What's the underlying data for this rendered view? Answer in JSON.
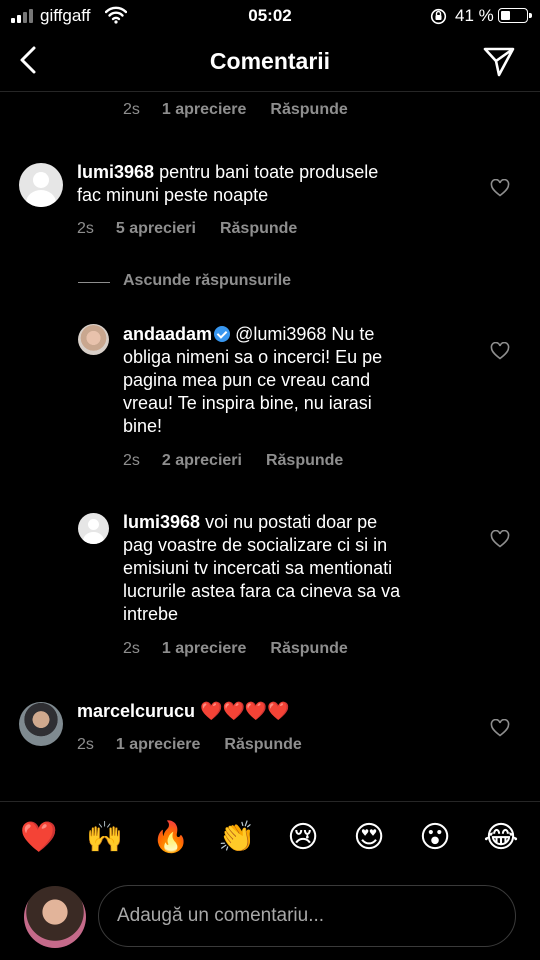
{
  "status_bar": {
    "carrier": "giffgaff",
    "time": "05:02",
    "battery_percent": "41 %",
    "battery_level": 0.41
  },
  "header": {
    "title": "Comentarii",
    "back_icon": "chevron-left-icon",
    "send_icon": "paper-plane-icon"
  },
  "comments": {
    "top_meta": {
      "time": "2s",
      "likes": "1 apreciere",
      "reply": "Răspunde"
    },
    "c1": {
      "username": "lumi3968",
      "text_line1": "pentru bani toate produsele",
      "text_line2": "fac minuni peste noapte",
      "time": "2s",
      "likes": "5 aprecieri",
      "reply": "Răspunde"
    },
    "hide_replies": "Ascunde răspunsurile",
    "r1": {
      "username": "andaadam",
      "mention": "@lumi3968",
      "text_line1": "Nu te",
      "text_line2": "obliga nimeni sa o incerci! Eu pe",
      "text_line3": "pagina mea pun ce vreau cand",
      "text_line4": "vreau! Te inspira bine, nu iarasi",
      "text_line5": "bine!",
      "time": "2s",
      "likes": "2 aprecieri",
      "reply": "Răspunde"
    },
    "r2": {
      "username": "lumi3968",
      "text_line1": "voi nu postati doar pe",
      "text_line2": "pag voastre de socializare ci si in",
      "text_line3": "emisiuni tv incercati sa mentionati",
      "text_line4": "lucrurile astea fara ca cineva sa va",
      "text_line5": "intrebe",
      "time": "2s",
      "likes": "1 apreciere",
      "reply": "Răspunde"
    },
    "c2": {
      "username": "marcelcurucu",
      "text": "❤️❤️❤️❤️",
      "time": "2s",
      "likes": "1 apreciere",
      "reply": "Răspunde"
    }
  },
  "emoji_bar": [
    "❤️",
    "🙌",
    "🔥",
    "👏",
    "😢",
    "😍",
    "😮",
    "😂"
  ],
  "composer": {
    "placeholder": "Adaugă un comentariu..."
  }
}
